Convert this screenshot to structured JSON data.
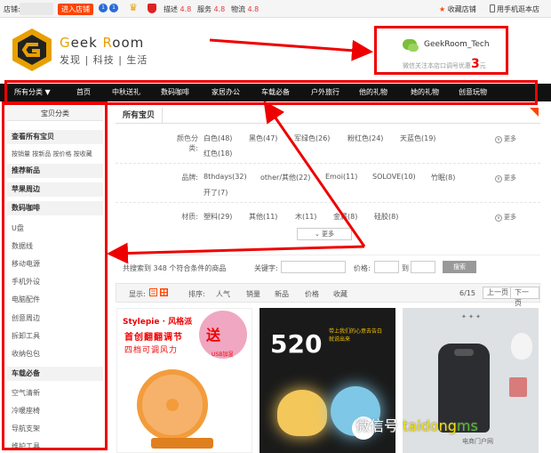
{
  "topbar": {
    "shop_label": "店铺:",
    "enter_shop": "进入店铺",
    "badge_a": "1",
    "badge_b": "1",
    "ratings": [
      {
        "label": "描述",
        "score": "4.8"
      },
      {
        "label": "服务",
        "score": "4.8"
      },
      {
        "label": "物流",
        "score": "4.8"
      }
    ],
    "favorite": "收藏店铺",
    "mobile": "用手机逛本店"
  },
  "header": {
    "brand_g": "G",
    "brand_eek": "eek ",
    "brand_r": "R",
    "brand_oom": "oom",
    "brand_cn": "发现 | 科技 | 生活",
    "wechat_id": "GeekRoom_Tech",
    "wechat_promo": "微信关注本店口调号优惠",
    "wechat_amount": "3",
    "wechat_unit": "元"
  },
  "nav": [
    {
      "label": "所有分类 ▼"
    },
    {
      "label": "首页"
    },
    {
      "label": "中秋送礼"
    },
    {
      "label": "数码咖啡"
    },
    {
      "label": "家居办公"
    },
    {
      "label": "车载必备"
    },
    {
      "label": "户外旅行"
    },
    {
      "label": "他的礼物"
    },
    {
      "label": "她的礼物"
    },
    {
      "label": "创意玩物"
    }
  ],
  "sidebar": {
    "title": "宝贝分类",
    "view_all": "查看所有宝贝",
    "sort_links": "按销量 按新品 按价格 按收藏",
    "heads": [
      "推荐新品",
      "苹果周边",
      "数码咖啡",
      "车载必备"
    ],
    "digital_items": [
      "U盘",
      "数据线",
      "移动电源",
      "手机外设",
      "电脑配件",
      "创意周边",
      "拆卸工具",
      "收纳包包"
    ],
    "car_items": [
      "空气清新",
      "冷暖座椅",
      "导航支架",
      "维护工具"
    ]
  },
  "main": {
    "tab": "所有宝贝",
    "filters": {
      "color_label": "颜色分类:",
      "colors": [
        "白色(48)",
        "黑色(47)",
        "军绿色(26)",
        "粉红色(24)",
        "天蓝色(19)",
        "红色(18)"
      ],
      "brand_label": "品牌:",
      "brands": [
        "8thdays(32)",
        "other/其他(22)",
        "Emoi(11)",
        "SOLOVE(10)",
        "竹眠(8)",
        "开了(7)"
      ],
      "material_label": "材质:",
      "materials": [
        "塑料(29)",
        "其他(11)",
        "木(11)",
        "金属(8)",
        "硅胶(8)"
      ],
      "more": "更多",
      "expand": "更多"
    },
    "search": {
      "found": "共搜索到 348 个符合条件的商品",
      "keyword_label": "关键字:",
      "price_label": "价格:",
      "to": "到",
      "button": "搜索"
    },
    "sort": {
      "display": "显示:",
      "sort_label": "排序:",
      "options": [
        "人气",
        "销量",
        "新品",
        "价格",
        "收藏"
      ],
      "page": "6/15",
      "prev": "上一页",
      "next": "下一页"
    },
    "products": {
      "p1_brand": "Stylepie · 风格派",
      "p1_line1": "首创翻翻调节",
      "p1_line2": "四档可调风力",
      "p1_gift": "送",
      "p1_usb": "USB加湿",
      "p2_number": "520",
      "p2_tag": "带上我们的心意去告白 就说出来",
      "watermark_a": "微信号",
      "watermark_b": "taidong",
      "watermark_c": "ms",
      "watermark_sub": "电商门户网"
    }
  },
  "colors": {
    "accent_red": "#e00000",
    "brand_gold": "#e8a000",
    "nav_bg": "#111111",
    "enter_orange": "#ff4400"
  }
}
